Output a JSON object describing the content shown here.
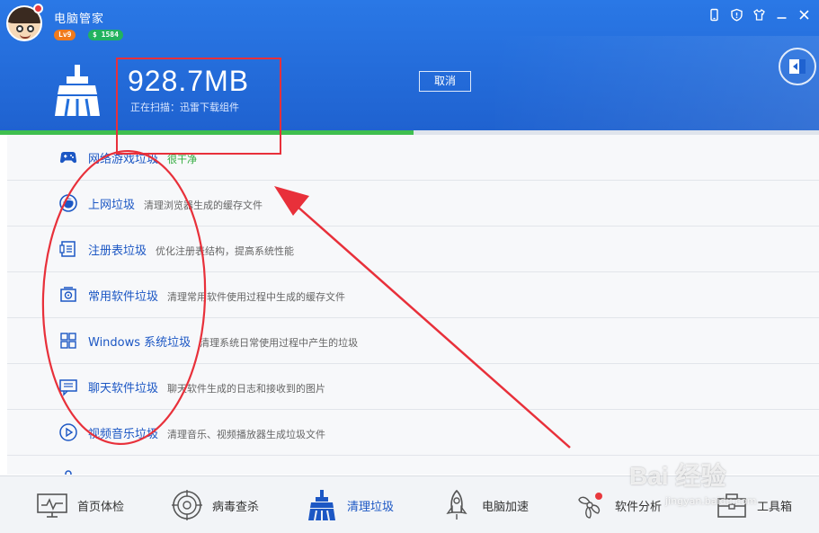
{
  "app": {
    "title": "电脑管家",
    "level_badge": "Lv9",
    "coins_badge": "$ 1584"
  },
  "window_controls": [
    {
      "name": "phone-icon"
    },
    {
      "name": "shield-icon"
    },
    {
      "name": "tshirt-skin-icon"
    },
    {
      "name": "minimize-icon"
    },
    {
      "name": "close-icon"
    }
  ],
  "scan": {
    "size": "928.7MB",
    "status": "正在扫描：迅雷下载组件",
    "cancel_label": "取消",
    "progress": 0.505,
    "progress_color": "#3fbf4f"
  },
  "items": [
    {
      "icon": "gamepad-icon",
      "title": "网络游戏垃圾",
      "desc": "很干净",
      "desc_color": "green"
    },
    {
      "icon": "browser-globe-icon",
      "title": "上网垃圾",
      "desc": "清理浏览器生成的缓存文件"
    },
    {
      "icon": "registry-icon",
      "title": "注册表垃圾",
      "desc": "优化注册表结构，提高系统性能"
    },
    {
      "icon": "software-disc-icon",
      "title": "常用软件垃圾",
      "desc": "清理常用软件使用过程中生成的缓存文件"
    },
    {
      "icon": "windows-icon",
      "title": "Windows 系统垃圾",
      "desc": "清理系统日常使用过程中产生的垃圾"
    },
    {
      "icon": "chat-icon",
      "title": "聊天软件垃圾",
      "desc": "聊天软件生成的日志和接收到的图片"
    },
    {
      "icon": "play-media-icon",
      "title": "视频音乐垃圾",
      "desc": "清理音乐、视频播放器生成垃圾文件"
    },
    {
      "icon": "plugin-icon",
      "title": "",
      "desc": ""
    }
  ],
  "nav": [
    {
      "icon": "monitor-checkup-icon",
      "label": "首页体检"
    },
    {
      "icon": "virus-target-icon",
      "label": "病毒查杀"
    },
    {
      "icon": "broom-clean-icon",
      "label": "清理垃圾",
      "active": true
    },
    {
      "icon": "rocket-icon",
      "label": "电脑加速"
    },
    {
      "icon": "software-fan-icon",
      "label": "软件分析"
    },
    {
      "icon": "toolbox-icon",
      "label": "工具箱"
    }
  ],
  "watermark": {
    "text": "Bai 经验",
    "sub": "jingyan.baidu.com"
  },
  "colors": {
    "header": "#2370dc",
    "link_blue": "#1c57c4",
    "annotation_red": "#e8303a"
  }
}
